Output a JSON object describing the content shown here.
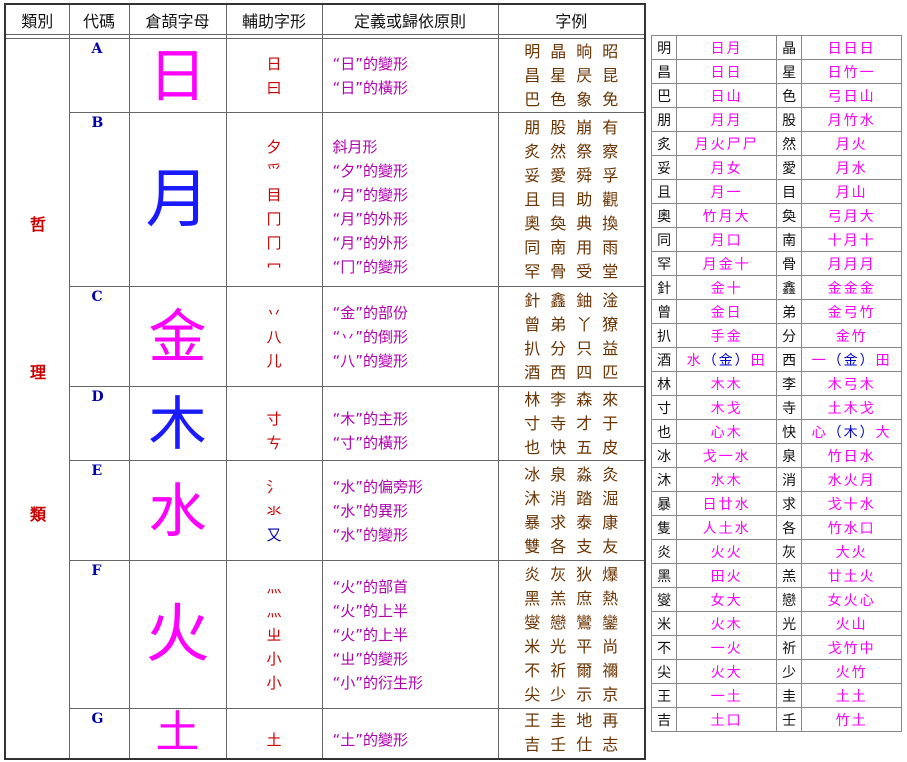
{
  "headers": [
    "類別",
    "代碼",
    "倉頡字母",
    "輔助字形",
    "定義或歸依原則",
    "字例"
  ],
  "category_chars": [
    "哲",
    "理",
    "類"
  ],
  "groups": [
    {
      "code": "A",
      "radical": "日",
      "aux": [
        "日",
        "曰"
      ],
      "defs": [
        "“日”的變形",
        "“日”的橫形"
      ],
      "examples": [
        "明晶晌昭",
        "昌星昃昆",
        "巴色象免"
      ]
    },
    {
      "code": "B",
      "radical": "月",
      "aux": [
        "夕",
        "爫",
        "目",
        "冂",
        "冂",
        "冖"
      ],
      "defs": [
        "斜月形",
        "“夕”的變形",
        "“月”的變形",
        "“月”的外形",
        "“月”的外形",
        "“冂”的變形"
      ],
      "examples": [
        "朋股崩有",
        "炙然祭察",
        "妥愛舜孚",
        "且目助觀",
        "奧奐典換",
        "同南用雨",
        "罕骨受堂"
      ]
    },
    {
      "code": "C",
      "radical": "金",
      "aux": [
        "丷",
        "八",
        "儿"
      ],
      "defs": [
        "“金”的部份",
        "“丷”的倒形",
        "“八”的變形"
      ],
      "examples": [
        "針鑫鈾淦",
        "曾弟丫獠",
        "扒分只益",
        "酒西四匹"
      ]
    },
    {
      "code": "D",
      "radical": "木",
      "aux": [
        "寸",
        "ㄘ"
      ],
      "defs": [
        "“木”的主形",
        "“寸”的橫形"
      ],
      "examples": [
        "林李森來",
        "寸寺才于",
        "也快五皮"
      ]
    },
    {
      "code": "E",
      "radical": "水",
      "aux": [
        "氵",
        "氺",
        "又"
      ],
      "defs": [
        "“水”的偏旁形",
        "“水”的異形",
        "“水”的變形"
      ],
      "examples": [
        "冰泉淼灸",
        "沐消踏淈",
        "暴求泰康",
        "雙各支友"
      ]
    },
    {
      "code": "F",
      "radical": "火",
      "aux": [
        "灬",
        "灬",
        "ㄓ",
        "小",
        "小"
      ],
      "defs": [
        "“火”的部首",
        "“火”的上半",
        "“火”的上半",
        "“ㄓ”的變形",
        "“小”的衍生形"
      ],
      "examples": [
        "炎灰狄爆",
        "黑羔庶熱",
        "燮戀鸞鑾",
        "米光平尚",
        "不祈爾禰",
        "尖少示京"
      ]
    },
    {
      "code": "G",
      "radical": "土",
      "aux": [
        "土"
      ],
      "defs": [
        "“土”的變形"
      ],
      "examples": [
        "王圭地再",
        "吉壬仕志"
      ]
    }
  ],
  "lookup": [
    [
      "明",
      "日月",
      "晶",
      "日日日"
    ],
    [
      "昌",
      "日日",
      "星",
      "日竹一"
    ],
    [
      "巴",
      "日山",
      "色",
      "弓日山"
    ],
    [
      "朋",
      "月月",
      "股",
      "月竹水"
    ],
    [
      "炙",
      "月火尸尸",
      "然",
      "月火"
    ],
    [
      "妥",
      "月女",
      "愛",
      "月水"
    ],
    [
      "且",
      "月一",
      "目",
      "月山"
    ],
    [
      "奧",
      "竹月大",
      "奐",
      "弓月大"
    ],
    [
      "同",
      "月口",
      "南",
      "十月十"
    ],
    [
      "罕",
      "月金十",
      "骨",
      "月月月"
    ],
    [
      "針",
      "金十",
      "鑫",
      "金金金"
    ],
    [
      "曾",
      "金日",
      "弟",
      "金弓竹"
    ],
    [
      "扒",
      "手金",
      "分",
      "金竹"
    ],
    [
      "酒",
      "水（金）田",
      "西",
      "一（金）田"
    ],
    [
      "林",
      "木木",
      "李",
      "木弓木"
    ],
    [
      "寸",
      "木戈",
      "寺",
      "土木戈"
    ],
    [
      "也",
      "心木",
      "快",
      "心（木）大"
    ],
    [
      "冰",
      "戈一水",
      "泉",
      "竹日水"
    ],
    [
      "沐",
      "水木",
      "消",
      "水火月"
    ],
    [
      "暴",
      "日廿水",
      "求",
      "戈十水"
    ],
    [
      "隻",
      "人土水",
      "各",
      "竹水口"
    ],
    [
      "炎",
      "火火",
      "灰",
      "大火"
    ],
    [
      "黑",
      "田火",
      "羔",
      "廿土火"
    ],
    [
      "燮",
      "女大",
      "戀",
      "女火心"
    ],
    [
      "米",
      "火木",
      "光",
      "火山"
    ],
    [
      "不",
      "一火",
      "祈",
      "戈竹中"
    ],
    [
      "尖",
      "火大",
      "少",
      "火竹"
    ],
    [
      "王",
      "一土",
      "圭",
      "土土"
    ],
    [
      "吉",
      "土口",
      "壬",
      "竹土"
    ]
  ]
}
